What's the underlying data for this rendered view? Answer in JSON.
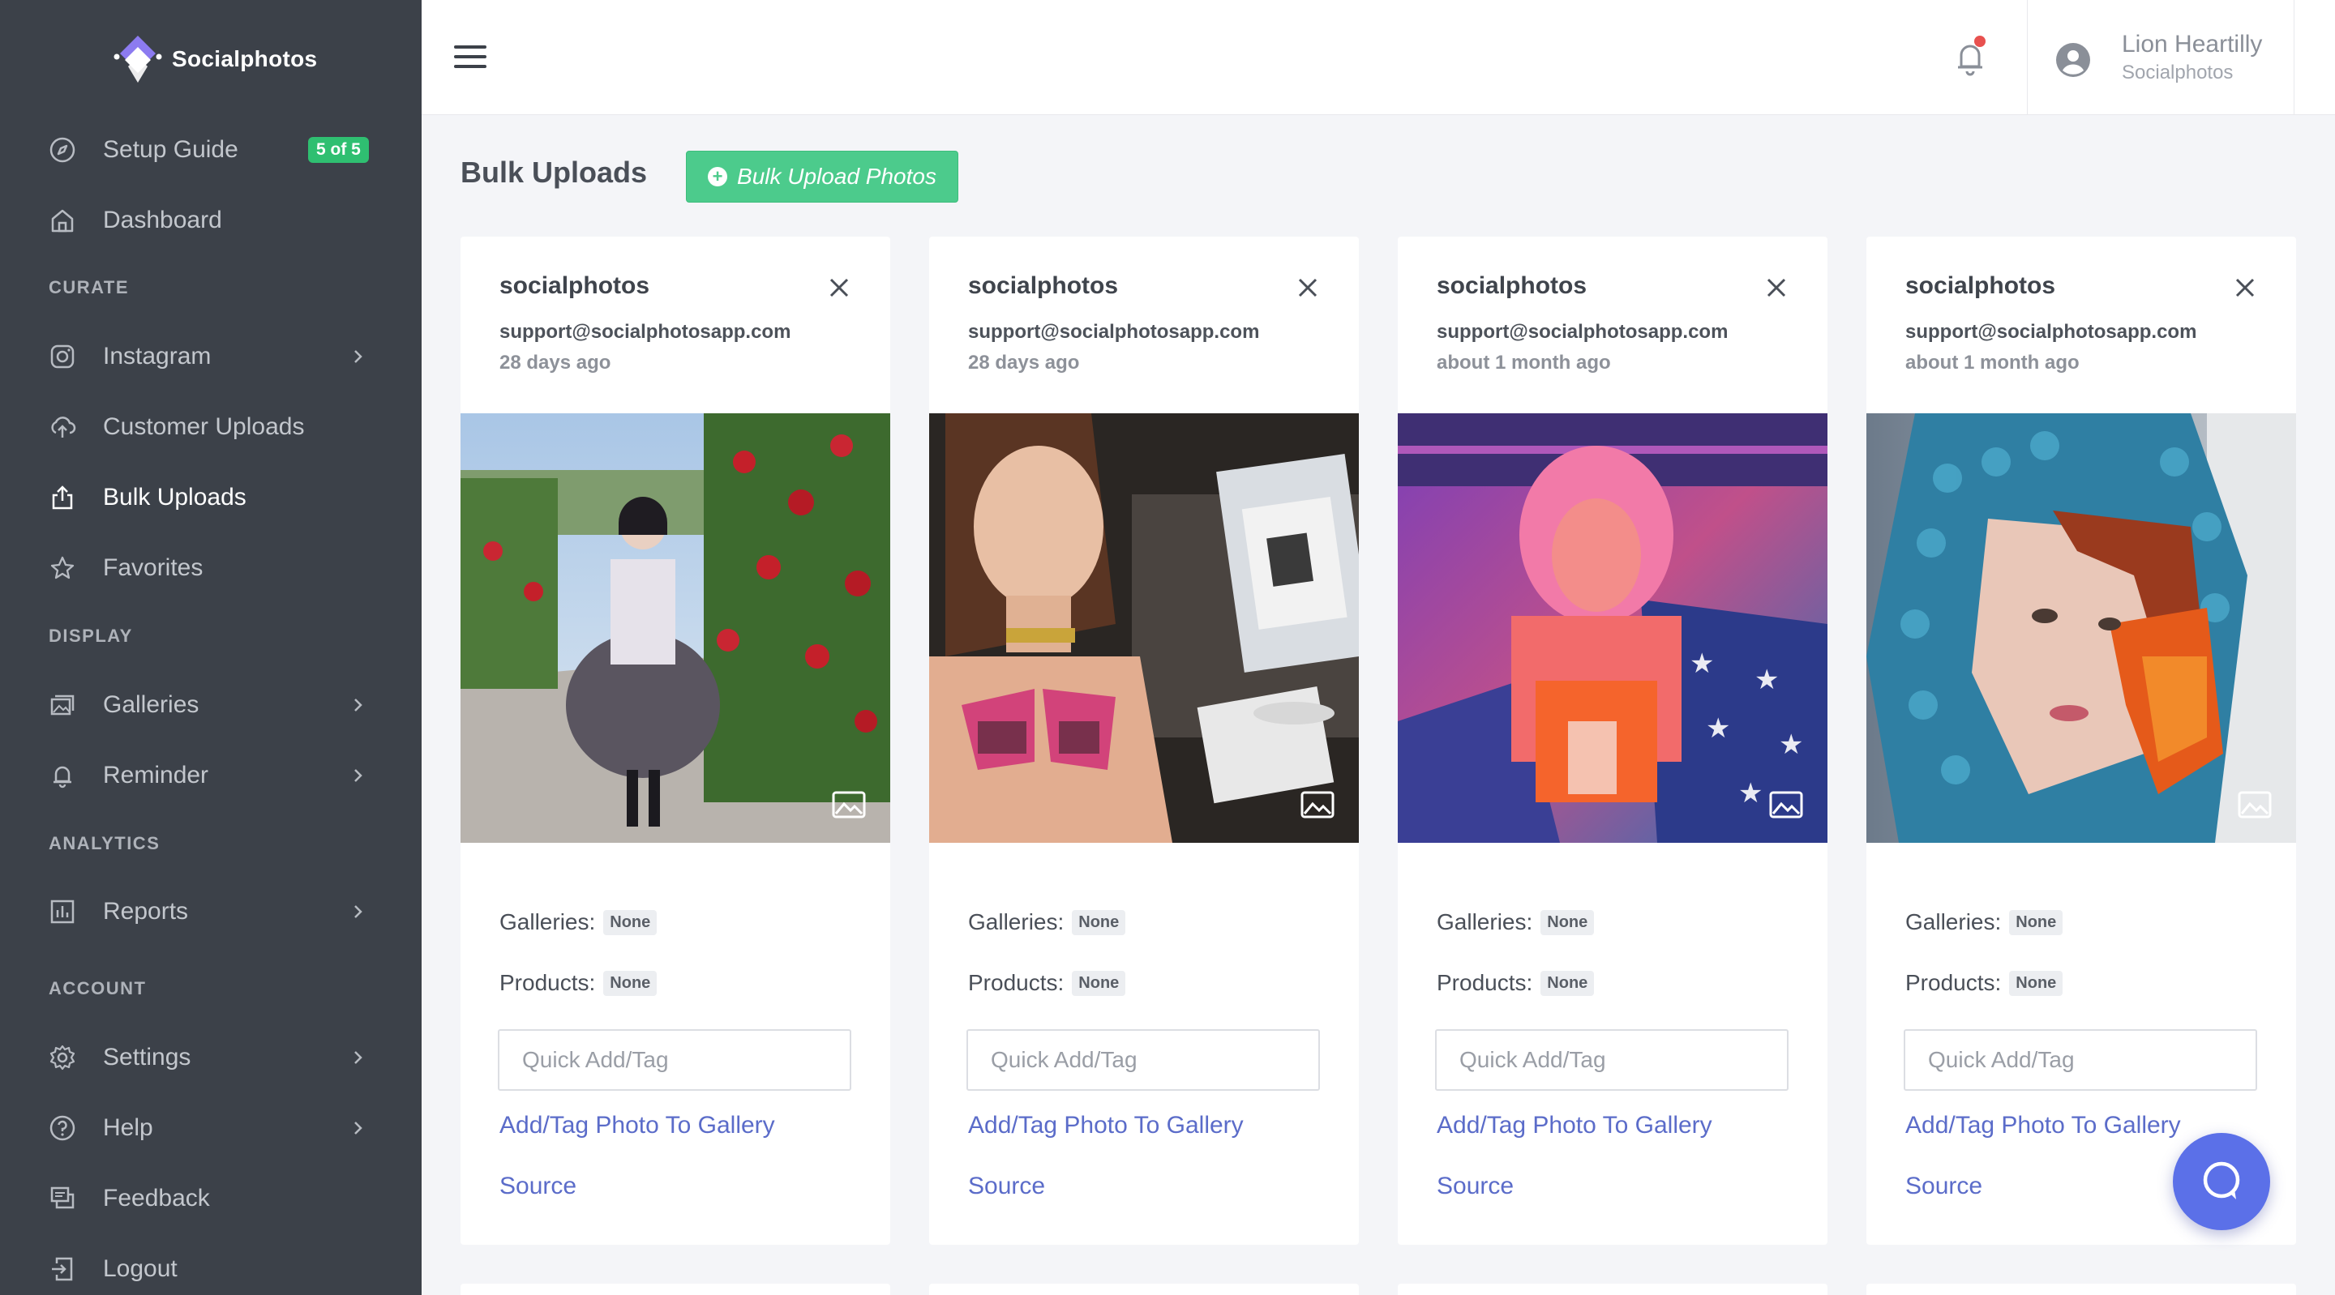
{
  "brand": {
    "name": "Socialphotos"
  },
  "sidebar": {
    "items": [
      {
        "label": "Setup Guide",
        "badge": "5 of 5",
        "icon": "compass-icon"
      },
      {
        "label": "Dashboard",
        "icon": "home-icon"
      },
      {
        "label": "Instagram",
        "icon": "instagram-icon"
      },
      {
        "label": "Customer Uploads",
        "icon": "cloud-upload-icon"
      },
      {
        "label": "Bulk Uploads",
        "icon": "share-upload-icon"
      },
      {
        "label": "Favorites",
        "icon": "star-icon"
      },
      {
        "label": "Galleries",
        "icon": "galleries-icon"
      },
      {
        "label": "Reminder",
        "icon": "bell-icon"
      },
      {
        "label": "Reports",
        "icon": "chart-icon"
      },
      {
        "label": "Settings",
        "icon": "gear-icon"
      },
      {
        "label": "Help",
        "icon": "help-icon"
      },
      {
        "label": "Feedback",
        "icon": "feedback-icon"
      },
      {
        "label": "Logout",
        "icon": "logout-icon"
      }
    ],
    "sections": {
      "curate": "CURATE",
      "display": "DISPLAY",
      "analytics": "ANALYTICS",
      "account": "ACCOUNT"
    }
  },
  "header": {
    "user_name": "Lion Heartilly",
    "user_org": "Socialphotos"
  },
  "page": {
    "title": "Bulk Uploads",
    "upload_button": "Bulk Upload Photos"
  },
  "card_labels": {
    "galleries": "Galleries:",
    "products": "Products:",
    "placeholder": "Quick Add/Tag",
    "add_link": "Add/Tag Photo To Gallery",
    "source_link": "Source"
  },
  "cards": [
    {
      "user": "socialphotos",
      "email": "support@socialphotosapp.com",
      "time": "28 days ago",
      "galleries": "None",
      "products": "None"
    },
    {
      "user": "socialphotos",
      "email": "support@socialphotosapp.com",
      "time": "28 days ago",
      "galleries": "None",
      "products": "None"
    },
    {
      "user": "socialphotos",
      "email": "support@socialphotosapp.com",
      "time": "about 1 month ago",
      "galleries": "None",
      "products": "None"
    },
    {
      "user": "socialphotos",
      "email": "support@socialphotosapp.com",
      "time": "about 1 month ago",
      "galleries": "None",
      "products": "None"
    }
  ],
  "colors": {
    "sidebar_bg": "#3c4149",
    "accent_green": "#4ccb8c",
    "link_blue": "#5b6cc9",
    "chat_blue": "#5b70e8"
  }
}
